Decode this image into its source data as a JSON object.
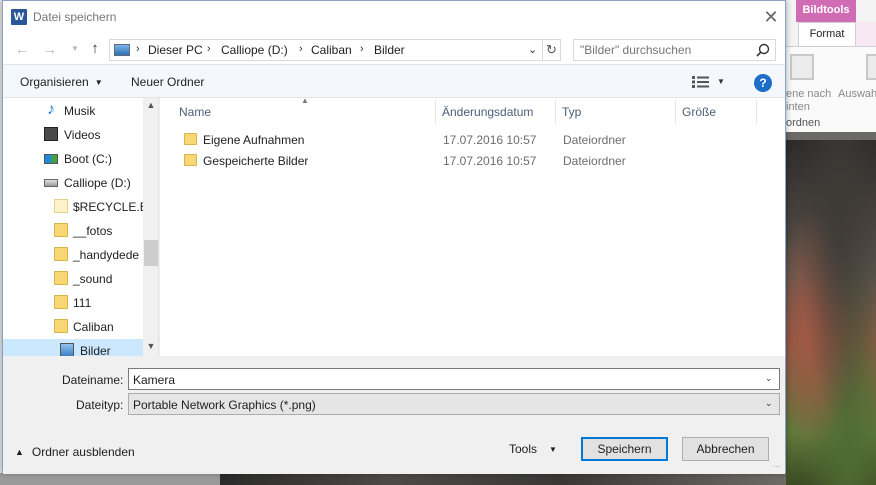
{
  "dialog": {
    "title": "Datei speichern",
    "app_icon_letter": "W",
    "close_symbol": "✕"
  },
  "address": {
    "breadcrumbs": [
      "Dieser PC",
      "Calliope (D:)",
      "Caliban",
      "Bilder"
    ],
    "search_placeholder": "\"Bilder\" durchsuchen"
  },
  "toolbar": {
    "organize_label": "Organisieren",
    "new_folder_label": "Neuer Ordner"
  },
  "nav_tree": [
    {
      "label": "Musik",
      "icon": "music-icon"
    },
    {
      "label": "Videos",
      "icon": "video-icon"
    },
    {
      "label": "Boot (C:)",
      "icon": "windows-drive-icon"
    },
    {
      "label": "Calliope (D:)",
      "icon": "drive-icon"
    },
    {
      "label": "$RECYCLE.BIN",
      "icon": "folder-icon"
    },
    {
      "label": "__fotos",
      "icon": "folder-icon"
    },
    {
      "label": "_handydede",
      "icon": "folder-icon"
    },
    {
      "label": "_sound",
      "icon": "folder-icon"
    },
    {
      "label": "111",
      "icon": "folder-icon"
    },
    {
      "label": "Caliban",
      "icon": "folder-icon"
    },
    {
      "label": "Bilder",
      "icon": "pictures-icon",
      "selected": true
    }
  ],
  "columns": {
    "name": "Name",
    "date": "Änderungsdatum",
    "type": "Typ",
    "size": "Größe"
  },
  "files": [
    {
      "name": "Eigene Aufnahmen",
      "date": "17.07.2016 10:57",
      "type": "Dateiordner"
    },
    {
      "name": "Gespeicherte Bilder",
      "date": "17.07.2016 10:57",
      "type": "Dateiordner"
    }
  ],
  "form": {
    "filename_label": "Dateiname:",
    "filename_value": "Kamera",
    "filetype_label": "Dateityp:",
    "filetype_value": "Portable Network Graphics (*.png)",
    "hide_folders_label": "Ordner ausblenden",
    "tools_label": "Tools",
    "save_label": "Speichern",
    "cancel_label": "Abbrechen"
  },
  "background_ribbon": {
    "group_tab": "Bildtools",
    "format_tab": "Format",
    "text_1": "ene nach",
    "text_2": "inten",
    "text_3": "Auswah",
    "group_label": "ordnen"
  },
  "colors": {
    "accent": "#0078d7",
    "selection": "#cce8ff",
    "folder": "#f8d775",
    "picture_tools": "#d06cb4"
  }
}
